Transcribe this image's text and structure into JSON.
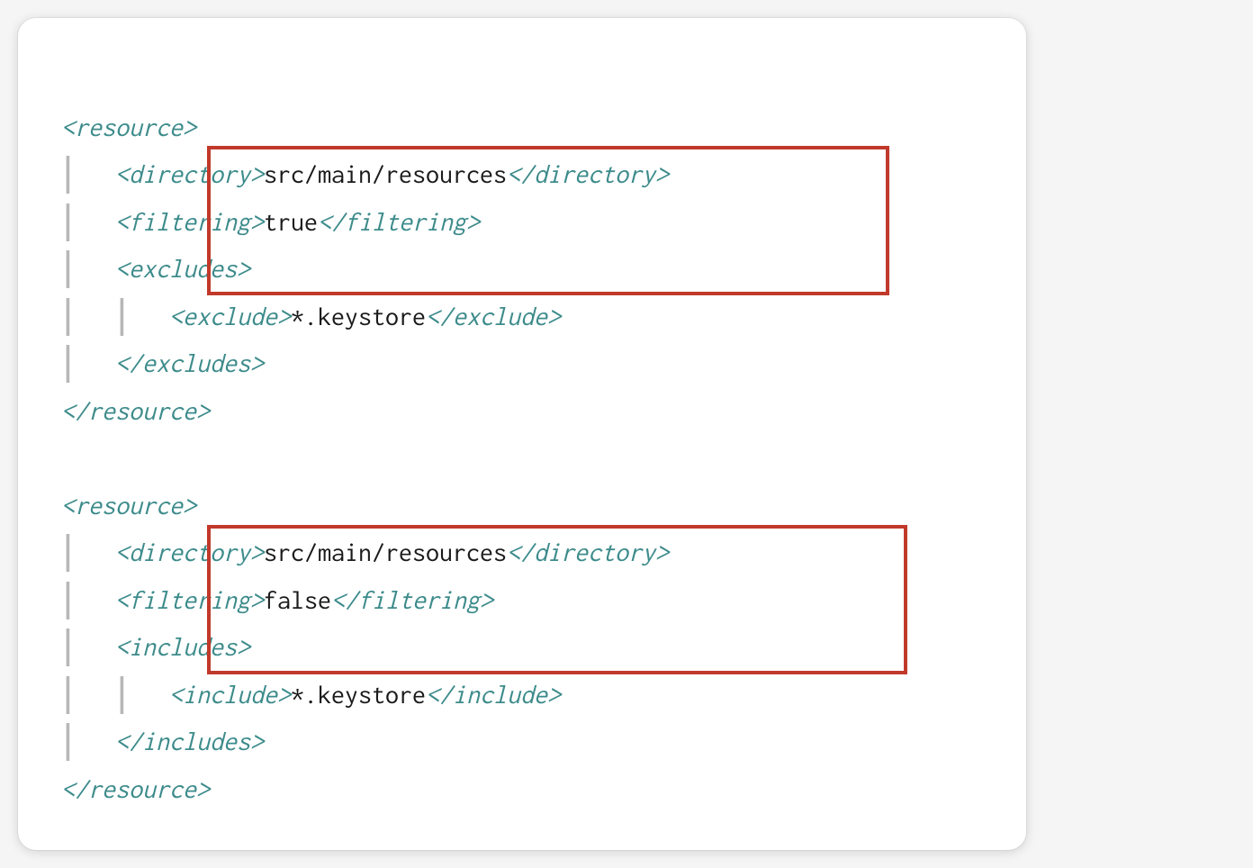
{
  "code": {
    "resource1": {
      "open": "<resource>",
      "directory_open": "<directory>",
      "directory_value": "src/main/resources",
      "directory_close": "</directory>",
      "filtering_open": "<filtering>",
      "filtering_value": "true",
      "filtering_close": "</filtering>",
      "excludes_open": "<excludes>",
      "exclude_open": "<exclude>",
      "exclude_value": "*.keystore",
      "exclude_close": "</exclude>",
      "excludes_close": "</excludes>",
      "close": "</resource>"
    },
    "resource2": {
      "open": "<resource>",
      "directory_open": "<directory>",
      "directory_value": "src/main/resources",
      "directory_close": "</directory>",
      "filtering_open": "<filtering>",
      "filtering_value": "false",
      "filtering_close": "</filtering>",
      "includes_open": "<includes>",
      "include_open": "<include>",
      "include_value": "*.keystore",
      "include_close": "</include>",
      "includes_close": "</includes>",
      "close": "</resource>"
    }
  },
  "colors": {
    "tag_color": "#3d8b8b",
    "highlight_border": "#c1392b"
  }
}
